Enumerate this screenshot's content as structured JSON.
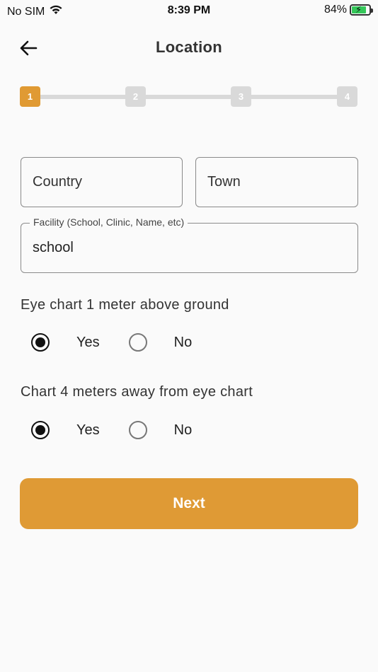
{
  "status_bar": {
    "carrier": "No SIM",
    "time": "8:39 PM",
    "battery_percent": "84%",
    "battery_level": 0.84,
    "battery_color": "#34c759"
  },
  "header": {
    "title": "Location",
    "back_icon": "arrow-left-icon"
  },
  "stepper": {
    "steps": [
      "1",
      "2",
      "3",
      "4"
    ],
    "active_step": 1,
    "active_color": "#e09a33",
    "inactive_color": "#d9d9d9"
  },
  "form": {
    "country": {
      "placeholder": "Country",
      "value": ""
    },
    "town": {
      "placeholder": "Town",
      "value": ""
    },
    "facility": {
      "label": "Facility (School, Clinic, Name, etc)",
      "value": "school"
    }
  },
  "questions": [
    {
      "text": "Eye chart 1 meter above ground",
      "options": [
        "Yes",
        "No"
      ],
      "selected": "Yes"
    },
    {
      "text": "Chart 4 meters away from eye chart",
      "options": [
        "Yes",
        "No"
      ],
      "selected": "Yes"
    }
  ],
  "actions": {
    "next_label": "Next",
    "next_color": "#df9a35"
  }
}
